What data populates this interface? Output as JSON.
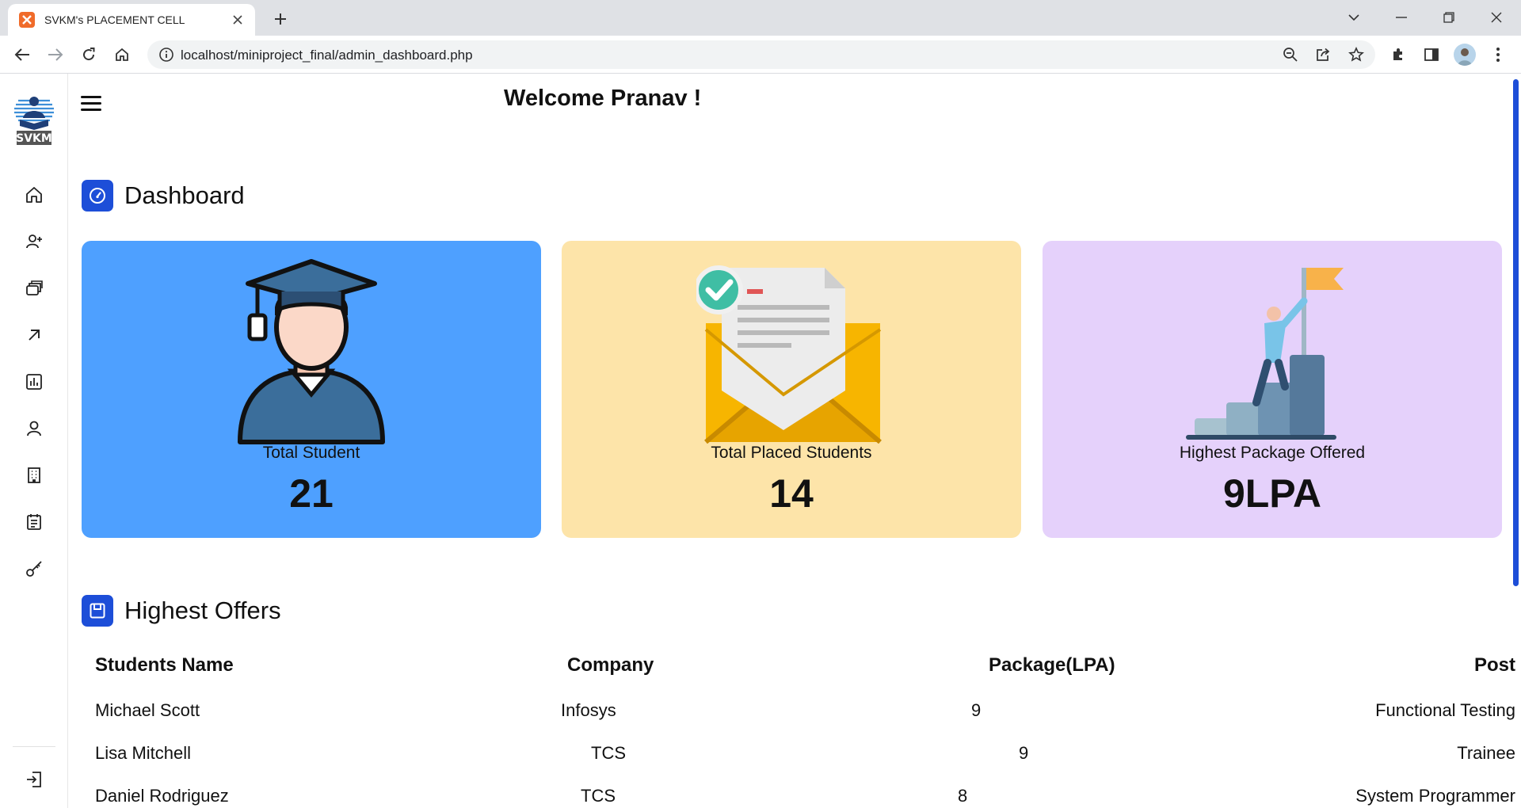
{
  "browser": {
    "tab_title": "SVKM's PLACEMENT CELL",
    "url": "localhost/miniproject_final/admin_dashboard.php"
  },
  "sidebar": {
    "logo_text": "SVKM",
    "items": [
      {
        "icon": "home-icon"
      },
      {
        "icon": "add-user-icon"
      },
      {
        "icon": "stack-icon"
      },
      {
        "icon": "arrow-up-right-icon"
      },
      {
        "icon": "bar-chart-icon"
      },
      {
        "icon": "user-icon"
      },
      {
        "icon": "building-icon"
      },
      {
        "icon": "clipboard-icon"
      },
      {
        "icon": "key-icon"
      }
    ],
    "logout_icon": "logout-icon"
  },
  "header": {
    "welcome": "Welcome Pranav !"
  },
  "dashboard": {
    "title": "Dashboard",
    "cards": [
      {
        "label": "Total Student",
        "value": "21",
        "color": "#4ea0ff"
      },
      {
        "label": "Total Placed Students",
        "value": "14",
        "color": "#fde4a9"
      },
      {
        "label": "Highest Package Offered",
        "value": "9LPA",
        "color": "#e5d1fb"
      }
    ]
  },
  "offers": {
    "title": "Highest Offers",
    "columns": [
      "Students Name",
      "Company",
      "Package(LPA)",
      "Post"
    ],
    "rows": [
      {
        "name": "Michael Scott",
        "company": "Infosys",
        "package": "9",
        "post": "Functional Testing"
      },
      {
        "name": "Lisa Mitchell",
        "company": "TCS",
        "package": "9",
        "post": "Trainee"
      },
      {
        "name": "Daniel Rodriguez",
        "company": "TCS",
        "package": "8",
        "post": "System Programmer"
      }
    ]
  },
  "colors": {
    "accent": "#1d4ed8",
    "card_blue": "#4ea0ff",
    "card_yellow": "#fde4a9",
    "card_purple": "#e5d1fb"
  }
}
